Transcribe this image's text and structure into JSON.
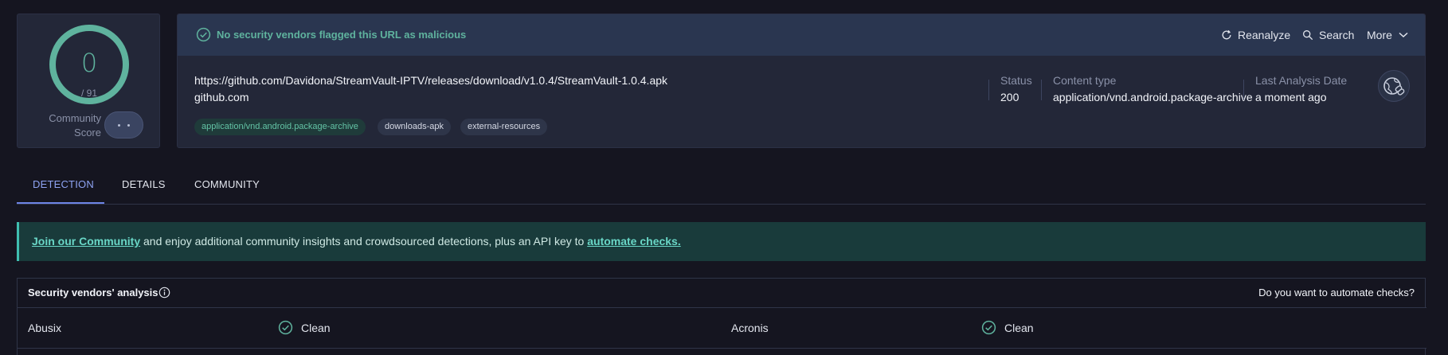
{
  "score": {
    "detections": "0",
    "total": "/ 91",
    "community_label": "Community Score"
  },
  "summary": {
    "verdict": "No security vendors flagged this URL as malicious",
    "actions": {
      "reanalyze": "Reanalyze",
      "search": "Search",
      "more": "More"
    },
    "url": "https://github.com/Davidona/StreamVault-IPTV/releases/download/v1.0.4/StreamVault-1.0.4.apk",
    "domain": "github.com",
    "tags": [
      "application/vnd.android.package-archive",
      "downloads-apk",
      "external-resources"
    ],
    "meta": {
      "status_label": "Status",
      "status_value": "200",
      "content_type_label": "Content type",
      "content_type_value": "application/vnd.android.package-archive",
      "last_analysis_label": "Last Analysis Date",
      "last_analysis_value": "a moment ago"
    }
  },
  "tabs": [
    "DETECTION",
    "DETAILS",
    "COMMUNITY"
  ],
  "banner": {
    "link_join": "Join our Community",
    "middle_text": " and enjoy additional community insights and crowdsourced detections, plus an API key to ",
    "link_automate": "automate checks."
  },
  "vendors": {
    "title": "Security vendors' analysis",
    "cta": "Do you want to automate checks?",
    "rows": [
      {
        "left_name": "Abusix",
        "left_result": "Clean",
        "right_name": "Acronis",
        "right_result": "Clean"
      }
    ]
  },
  "colors": {
    "clean_green": "#5fb39e",
    "accent_blue": "#6d84e6",
    "background": "#151520",
    "card": "#232738"
  }
}
